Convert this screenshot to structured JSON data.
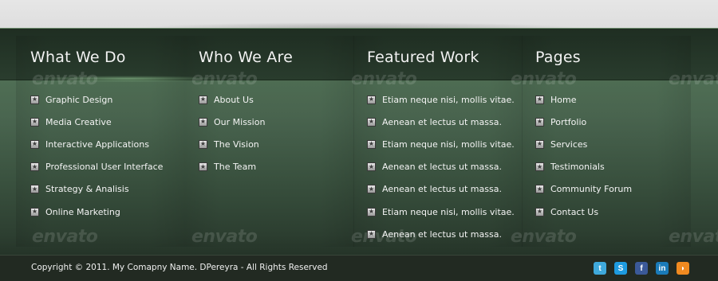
{
  "columns": [
    {
      "title": "What We Do",
      "items": [
        "Graphic Design",
        "Media Creative",
        "Interactive Applications",
        "Professional User Interface",
        "Strategy & Analisis",
        "Online Marketing"
      ]
    },
    {
      "title": "Who We Are",
      "items": [
        "About Us",
        "Our Mission",
        "The Vision",
        "The Team"
      ]
    },
    {
      "title": "Featured Work",
      "items": [
        "Etiam neque nisi, mollis vitae.",
        "Aenean et lectus ut massa.",
        "Etiam neque nisi, mollis vitae.",
        "Aenean et lectus ut massa.",
        "Aenean et lectus ut massa.",
        "Etiam neque nisi, mollis vitae.",
        "Aenean et lectus ut massa."
      ]
    },
    {
      "title": "Pages",
      "items": [
        "Home",
        "Portfolio",
        "Services",
        "Testimonials",
        "Community Forum",
        "Contact Us"
      ]
    }
  ],
  "watermark_text": "envato",
  "copyright": "Copyright © 2011. My Comapny Name. DPereyra - All Rights Reserved",
  "social_icons": [
    {
      "name": "twitter-icon",
      "glyph": "t",
      "color": "#3fa9dc"
    },
    {
      "name": "skype-icon",
      "glyph": "S",
      "color": "#1e9be0"
    },
    {
      "name": "facebook-icon",
      "glyph": "f",
      "color": "#3b5998"
    },
    {
      "name": "linkedin-icon",
      "glyph": "in",
      "color": "#1a7bb9"
    },
    {
      "name": "rss-icon",
      "glyph": "◗",
      "color": "#f08a20"
    }
  ],
  "bullet_icon": "star-icon",
  "colors": {
    "header_band": "#1f2e22",
    "body_green": "#4a6650",
    "bottom_bar": "#222a22"
  }
}
